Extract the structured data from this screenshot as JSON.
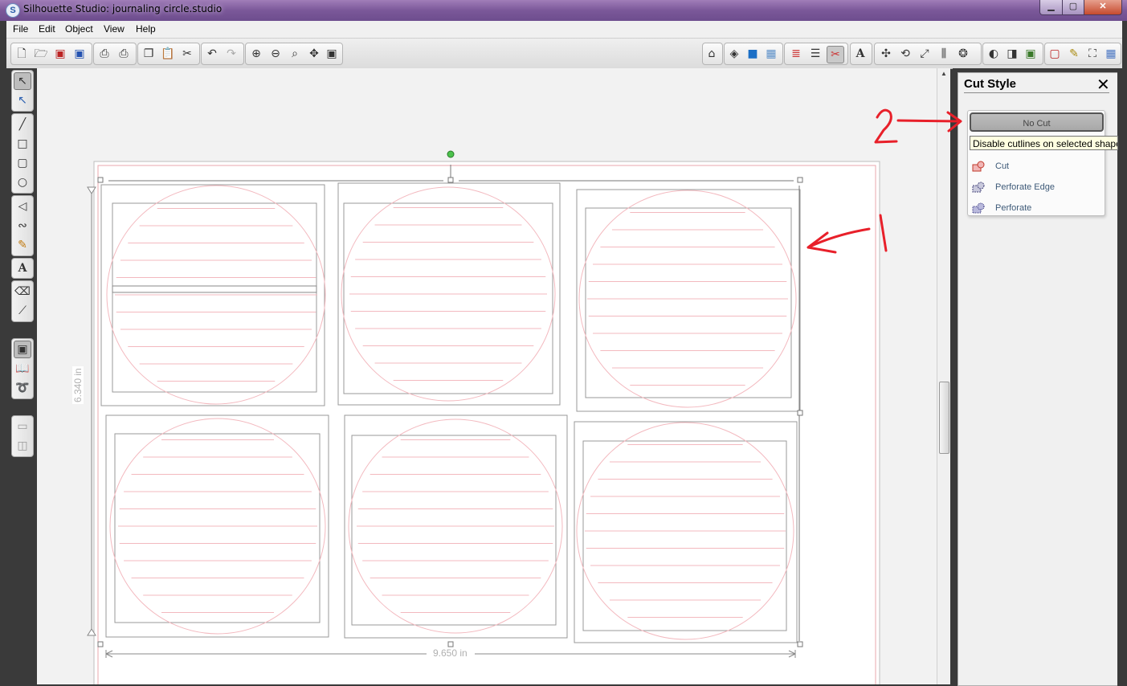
{
  "window": {
    "title": "Silhouette Studio: journaling circle.studio",
    "app_icon_glyph": "S",
    "controls": [
      "minimize-icon",
      "maximize-icon",
      "close-icon"
    ]
  },
  "menu": {
    "items": [
      "File",
      "Edit",
      "Object",
      "View",
      "Help"
    ]
  },
  "toolbar": {
    "left_icons": [
      "new-document-icon",
      "open-folder-icon",
      "save-icon",
      "save-to-library-icon",
      "print-icon",
      "print-cut-icon",
      "copy-icon",
      "paste-icon",
      "cut-scissors-icon",
      "undo-icon",
      "redo-icon",
      "zoom-in-icon",
      "zoom-out-icon",
      "zoom-select-icon",
      "pan-icon",
      "fit-page-icon"
    ],
    "right_icons": [
      "store-icon",
      "fill-color-icon",
      "fill-gradient-icon",
      "fill-pattern-icon",
      "line-color-icon",
      "line-style-icon",
      "cut-settings-icon",
      "text-style-icon",
      "replicate-icon",
      "transform-icon",
      "scale-icon",
      "align-icon",
      "modify-icon",
      "trace-icon",
      "offset-icon",
      "page-settings-icon",
      "registration-icon",
      "cutting-mat-icon",
      "sketch-pen-icon",
      "fullscreen-icon",
      "grid-icon"
    ]
  },
  "left_tools": [
    "select-tool-icon",
    "point-edit-tool-icon",
    "line-tool-icon",
    "rectangle-tool-icon",
    "rounded-rectangle-tool-icon",
    "ellipse-tool-icon",
    "polygon-tool-icon",
    "curve-tool-icon",
    "freehand-tool-icon",
    "text-tool-icon",
    "eraser-tool-icon",
    "knife-tool-icon",
    "page-view-icon",
    "library-icon",
    "lasso-icon",
    "layer-view-icon",
    "split-view-icon"
  ],
  "canvas": {
    "height_label": "6.340 in",
    "width_label": "9.650 in"
  },
  "panel": {
    "title": "Cut Style",
    "no_cut_label": "No Cut",
    "tooltip": "Disable cutlines on selected shape",
    "options": [
      {
        "label": "Cut",
        "icon": "cut-style-icon"
      },
      {
        "label": "Perforate Edge",
        "icon": "perforate-edge-icon"
      },
      {
        "label": "Perforate",
        "icon": "perforate-icon"
      }
    ]
  },
  "annotations": {
    "label_1": "1",
    "label_2": "2",
    "color": "#e8202a"
  },
  "colors": {
    "cutline_pink": "#f3b9bf",
    "titlebar_purple": "#7b5899",
    "tooltip_bg": "#ffffe1"
  }
}
